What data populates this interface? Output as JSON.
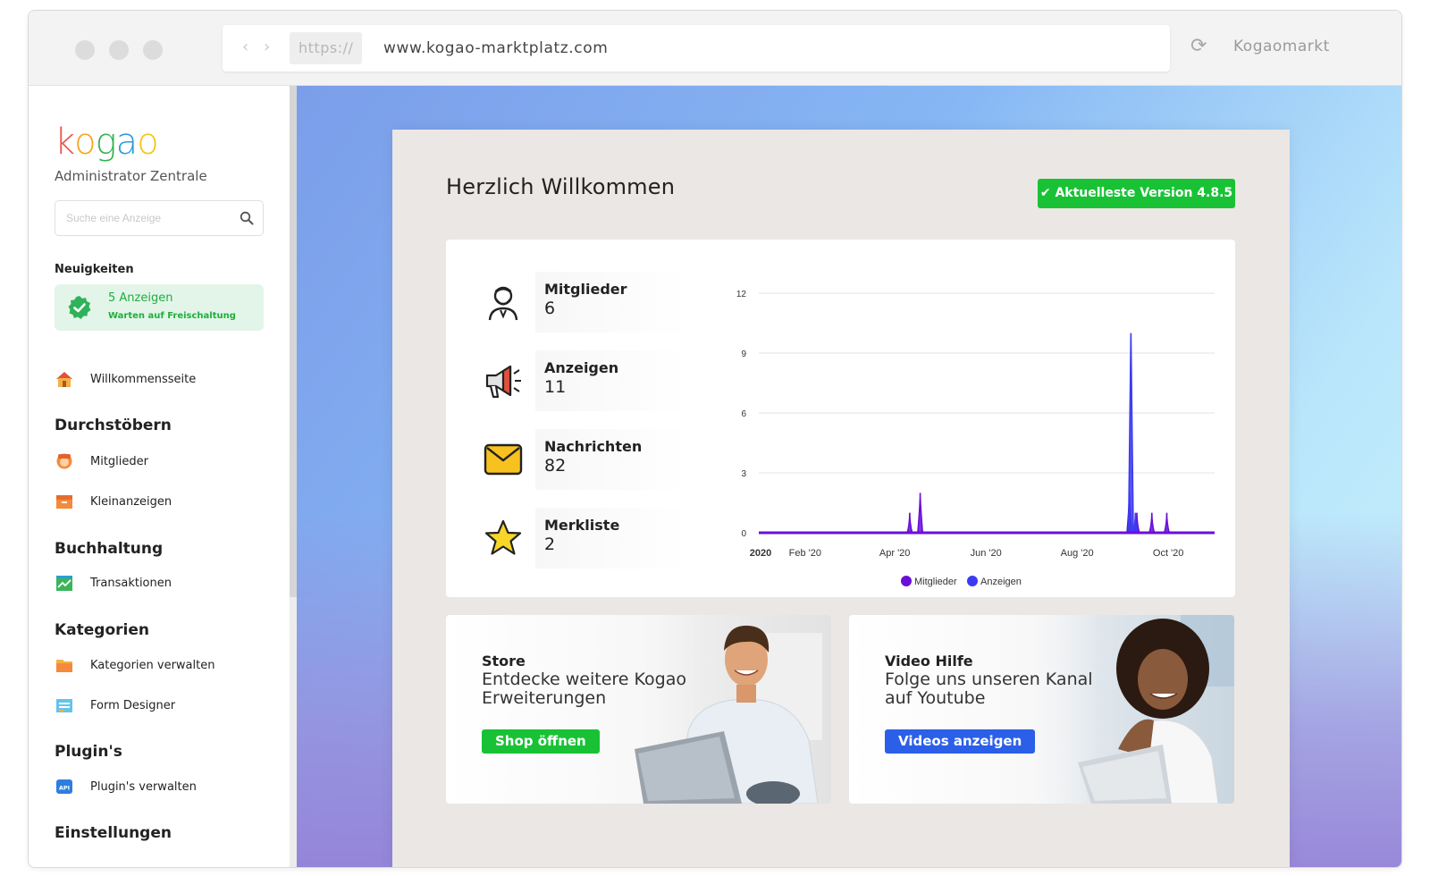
{
  "browser": {
    "protocol": "https://",
    "url": "www.kogao-marktplatz.com",
    "site_name": "Kogaomarkt"
  },
  "sidebar": {
    "logo_letters": [
      "k",
      "o",
      "g",
      "a",
      "o"
    ],
    "logo_colors": [
      "#f0504a",
      "#f5a623",
      "#34b352",
      "#2d9cdb",
      "#f5c518"
    ],
    "subtitle": "Administrator Zentrale",
    "search_placeholder": "Suche eine Anzeige",
    "news_heading": "Neuigkeiten",
    "news_title": "5 Anzeigen",
    "news_subtitle": "Warten auf Freischaltung",
    "welcome_item": "Willkommensseite",
    "sections": {
      "browse": "Durchstöbern",
      "accounting": "Buchhaltung",
      "categories": "Kategorien",
      "plugins": "Plugin's",
      "settings": "Einstellungen"
    },
    "items": {
      "members": "Mitglieder",
      "classifieds": "Kleinanzeigen",
      "transactions": "Transaktionen",
      "manage_categories": "Kategorien verwalten",
      "form_designer": "Form Designer",
      "manage_plugins": "Plugin's verwalten"
    }
  },
  "main": {
    "welcome": "Herzlich Willkommen",
    "version_label": "✔ Aktuelleste Version 4.8.5",
    "stats": [
      {
        "label": "Mitglieder",
        "value": "6",
        "icon": "user-icon"
      },
      {
        "label": "Anzeigen",
        "value": "11",
        "icon": "megaphone-icon"
      },
      {
        "label": "Nachrichten",
        "value": "82",
        "icon": "envelope-icon"
      },
      {
        "label": "Merkliste",
        "value": "2",
        "icon": "star-icon"
      }
    ],
    "promos": {
      "store_kicker": "Store",
      "store_text": "Entdecke weitere Kogao Erweiterungen",
      "store_button": "Shop öffnen",
      "video_kicker": "Video Hilfe",
      "video_text": "Folge uns unseren Kanal auf Youtube",
      "video_button": "Videos anzeigen"
    }
  },
  "colors": {
    "green": "#19c235",
    "blue": "#2b5fe8",
    "series_members": "#6a0fd8",
    "series_ads": "#3b3bf0"
  },
  "chart_data": {
    "type": "area",
    "ylim": [
      0,
      12
    ],
    "yticks": [
      0,
      3,
      6,
      9,
      12
    ],
    "xticks": [
      "2020",
      "Feb '20",
      "Apr '20",
      "Jun '20",
      "Aug '20",
      "Oct '20"
    ],
    "legend": [
      "Mitglieder",
      "Anzeigen"
    ],
    "legend_placement": "bottom",
    "series": [
      {
        "name": "Mitglieder",
        "points": [
          [
            "2020-04-11",
            1
          ],
          [
            "2020-04-18",
            2
          ],
          [
            "2020-09-05",
            2
          ],
          [
            "2020-09-10",
            1
          ],
          [
            "2020-09-20",
            1
          ],
          [
            "2020-09-30",
            1
          ]
        ]
      },
      {
        "name": "Anzeigen",
        "points": [
          [
            "2020-09-06",
            10
          ],
          [
            "2020-09-09",
            1
          ]
        ]
      }
    ]
  }
}
